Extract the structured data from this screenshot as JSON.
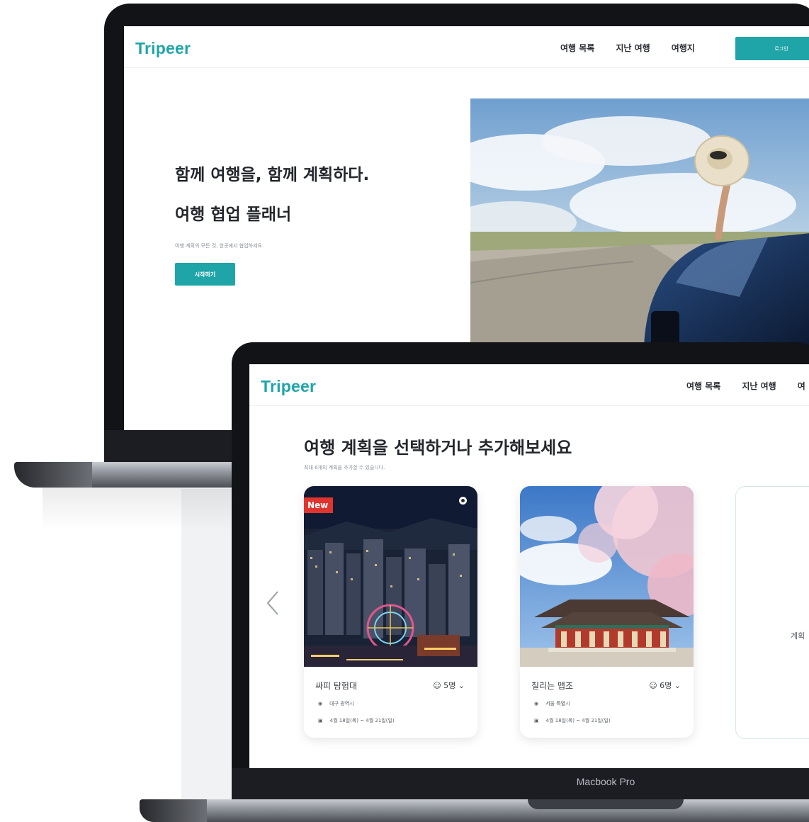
{
  "back_screen": {
    "logo": "Tripeer",
    "nav": [
      "여행 목록",
      "지난 여행",
      "여행지"
    ],
    "login_label": "로그인",
    "hero_title_1": "함께 여행을, 함께 계획하다.",
    "hero_title_2": "여행 협업 플래너",
    "hero_desc": "여행 계획의 모든 것, 한곳에서 협업하세요.",
    "start_label": "시작하기"
  },
  "front_screen": {
    "logo": "Tripeer",
    "nav": [
      "여행 목록",
      "지난 여행",
      "여"
    ],
    "section_title": "여행 계획을 선택하거나 추가해보세요",
    "section_sub": "최대 6개의 계획을 추가할 수 있습니다.",
    "cards": [
      {
        "badge": "New",
        "title": "싸피 탐험대",
        "members": "5명",
        "location": "대구 광역시",
        "dates": "4월 18일(목) ~ 4월 21일(일)"
      },
      {
        "title": "칠리는 맵조",
        "members": "6명",
        "location": "서울 특별시",
        "dates": "4월 18일(목) ~ 4월 21일(일)"
      }
    ],
    "add_card_label": "계획"
  },
  "device_label": "Macbook Pro",
  "colors": {
    "brand": "#1fa5a8",
    "badge": "#e0342e",
    "bezel": "#121317"
  }
}
